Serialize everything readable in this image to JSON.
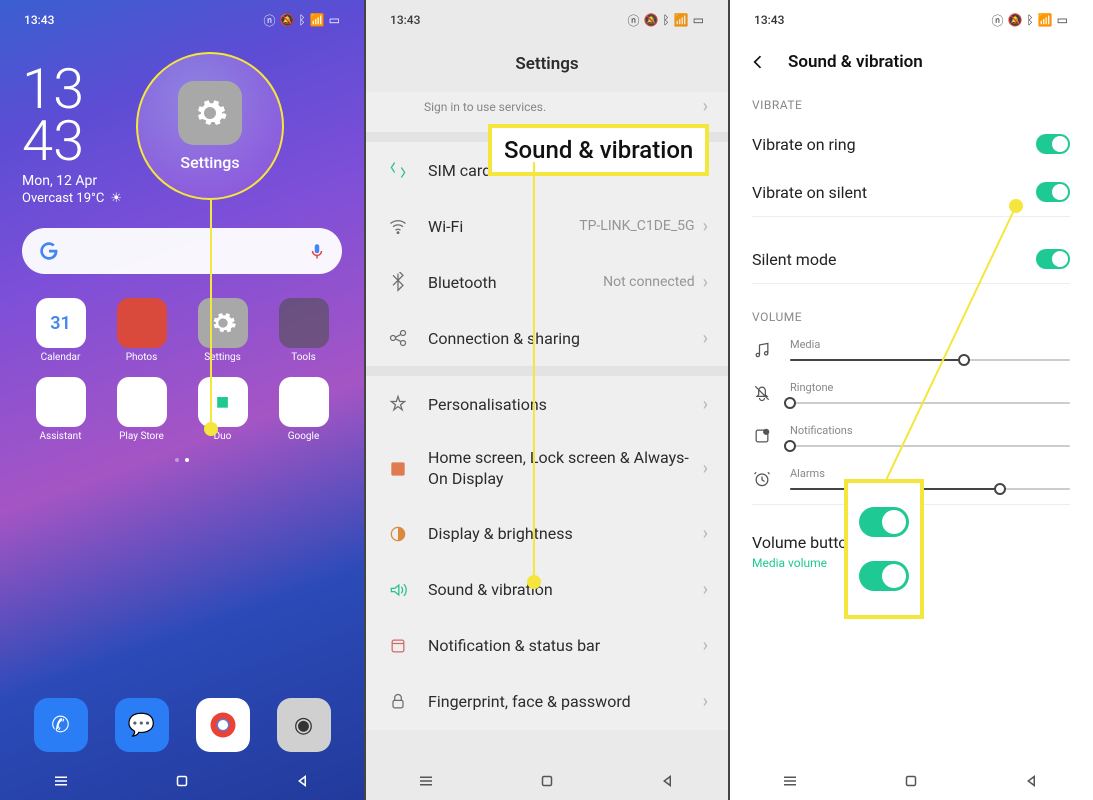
{
  "status": {
    "time": "13:43",
    "icons": [
      "nfc",
      "mute",
      "bluetooth",
      "wifi",
      "signal",
      "battery"
    ]
  },
  "home": {
    "clock_hr": "13",
    "clock_min": "43",
    "date": "Mon, 12 Apr",
    "weather": "Overcast 19°C",
    "apps": [
      {
        "label": "Calendar",
        "color": "#fff",
        "emoji": "31"
      },
      {
        "label": "Photos",
        "color": "#d94a3c"
      },
      {
        "label": "Settings",
        "color": "#a8a8a8"
      },
      {
        "label": "Tools",
        "color": "#6a6a6a"
      },
      {
        "label": "Assistant",
        "color": "#fff"
      },
      {
        "label": "Play Store",
        "color": "#fff"
      },
      {
        "label": "Duo",
        "color": "#fff"
      },
      {
        "label": "Google",
        "color": "#fff"
      }
    ],
    "dock": [
      {
        "name": "phone",
        "color": "#2a7df5"
      },
      {
        "name": "messages",
        "color": "#2a7df5"
      },
      {
        "name": "chrome",
        "color": "#fff"
      },
      {
        "name": "camera",
        "color": "#d0d0d0"
      }
    ],
    "callout_label": "Settings"
  },
  "settings": {
    "title": "Settings",
    "signin_sub": "Sign in to use services.",
    "rows": [
      {
        "icon": "sim",
        "label": "SIM card & mobile data"
      },
      {
        "icon": "wifi",
        "label": "Wi-Fi",
        "value": "TP-LINK_C1DE_5G"
      },
      {
        "icon": "bt",
        "label": "Bluetooth",
        "value": "Not connected"
      },
      {
        "icon": "share",
        "label": "Connection & sharing"
      }
    ],
    "rows2": [
      {
        "icon": "person",
        "label": "Personalisations"
      },
      {
        "icon": "home",
        "label": "Home screen, Lock screen & Always-On Display"
      },
      {
        "icon": "bright",
        "label": "Display & brightness"
      },
      {
        "icon": "sound",
        "label": "Sound & vibration",
        "green": true
      },
      {
        "icon": "notif",
        "label": "Notification & status bar"
      },
      {
        "icon": "lock",
        "label": "Fingerprint, face & password"
      }
    ],
    "callout": "Sound & vibration"
  },
  "sv": {
    "title": "Sound & vibration",
    "vibrate_section": "Vibrate",
    "vibrate_ring": "Vibrate on ring",
    "vibrate_silent": "Vibrate on silent",
    "silent_mode": "Silent mode",
    "volume_section": "Volume",
    "media": "Media",
    "ringtone": "Ringtone",
    "notifications": "Notifications",
    "alarms": "Alarms",
    "sliders": {
      "media": 62,
      "ringtone": 0,
      "notifications": 0,
      "alarms": 75
    },
    "vbf": "Volume button function",
    "vbf_sub": "Media volume"
  }
}
